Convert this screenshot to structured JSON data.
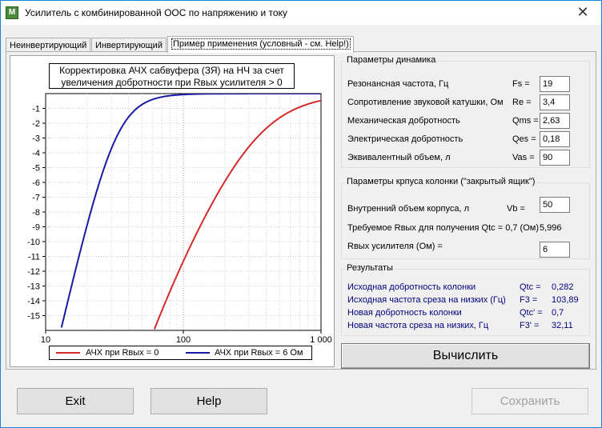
{
  "window": {
    "title": "Усилитель с комбинированной ООС по напряжению и току",
    "app_icon": "app-icon",
    "close_glyph": "✕"
  },
  "tabs": [
    {
      "label": "Неинвертирующий",
      "active": false
    },
    {
      "label": "Инвертирующий",
      "active": false
    },
    {
      "label": "Пример применения (условный - см. Help!)",
      "active": true
    }
  ],
  "chart": {
    "title_line1": "Корректировка АЧХ сабвуфера (ЗЯ) на НЧ за счет",
    "title_line2": "увеличения добротности при Rвых усилителя > 0",
    "x_tick_labels": [
      "10",
      "100",
      "1 000"
    ],
    "y_tick_labels": [
      "-1",
      "-2",
      "-3",
      "-4",
      "-5",
      "-6",
      "-7",
      "-8",
      "-9",
      "-10",
      "-11",
      "-12",
      "-13",
      "-14",
      "-15"
    ],
    "legend": [
      {
        "label": "АЧХ при Rвых = 0",
        "color": "#d42a2a"
      },
      {
        "label": "АЧХ при Rвых = 6  Ом",
        "color": "#1a1aa6"
      }
    ]
  },
  "chart_data": {
    "type": "line",
    "title": "Корректировка АЧХ сабвуфера (ЗЯ) на НЧ за счет увеличения добротности при Rвых усилителя > 0",
    "xlabel": "",
    "ylabel": "",
    "x_scale": "log",
    "xlim": [
      10,
      1000
    ],
    "ylim": [
      -16,
      0
    ],
    "grid": true,
    "legend_position": "bottom",
    "series": [
      {
        "name": "АЧХ при Rвых = 0",
        "color": "#d42a2a",
        "fc": 103.89,
        "qtc": 0.282
      },
      {
        "name": "АЧХ при Rвых = 6  Ом",
        "color": "#1a1aa6",
        "fc": 32.11,
        "qtc": 0.7
      }
    ]
  },
  "dynamics": {
    "legend": "Параметры динамика",
    "rows": [
      {
        "label": "Резонансная частота, Гц",
        "sym": "Fs =",
        "value": "19"
      },
      {
        "label": "Сопротивление звуковой катушки, Ом",
        "sym": "Re =",
        "value": "3,4"
      },
      {
        "label": "Механическая добротность",
        "sym": "Qms =",
        "value": "2,63"
      },
      {
        "label": "Электрическая добротность",
        "sym": "Qes =",
        "value": "0,18"
      },
      {
        "label": "Эквивалентный объем, л",
        "sym": "Vas =",
        "value": "90"
      }
    ]
  },
  "box": {
    "legend": "Параметры крпуса колонки (\"закрытый ящик\")",
    "volume_label": "Внутренний объем корпуса, л",
    "volume_sym": "Vb =",
    "volume_value": "50",
    "required_label": "Требуемое Rвых для получения Qtc = 0,7 (Ом)",
    "required_value": "5,996",
    "rout_label": "Rвых усилителя (Ом) =",
    "rout_value": "6"
  },
  "results": {
    "legend": "Результаты",
    "rows": [
      {
        "label": "Исходная добротность колонки",
        "sym": "Qtc =",
        "value": "0,282"
      },
      {
        "label": "Исходная частота среза на низких (Гц)",
        "sym": "F3 =",
        "value": "103,89"
      },
      {
        "label": "Новая добротность колонки",
        "sym": "Qtc' =",
        "value": "0,7"
      },
      {
        "label": "Новая частота среза на низких, Гц",
        "sym": "F3' =",
        "value": "32,11"
      }
    ]
  },
  "buttons": {
    "calculate": "Вычислить",
    "exit": "Exit",
    "help": "Help",
    "save": "Сохранить"
  }
}
